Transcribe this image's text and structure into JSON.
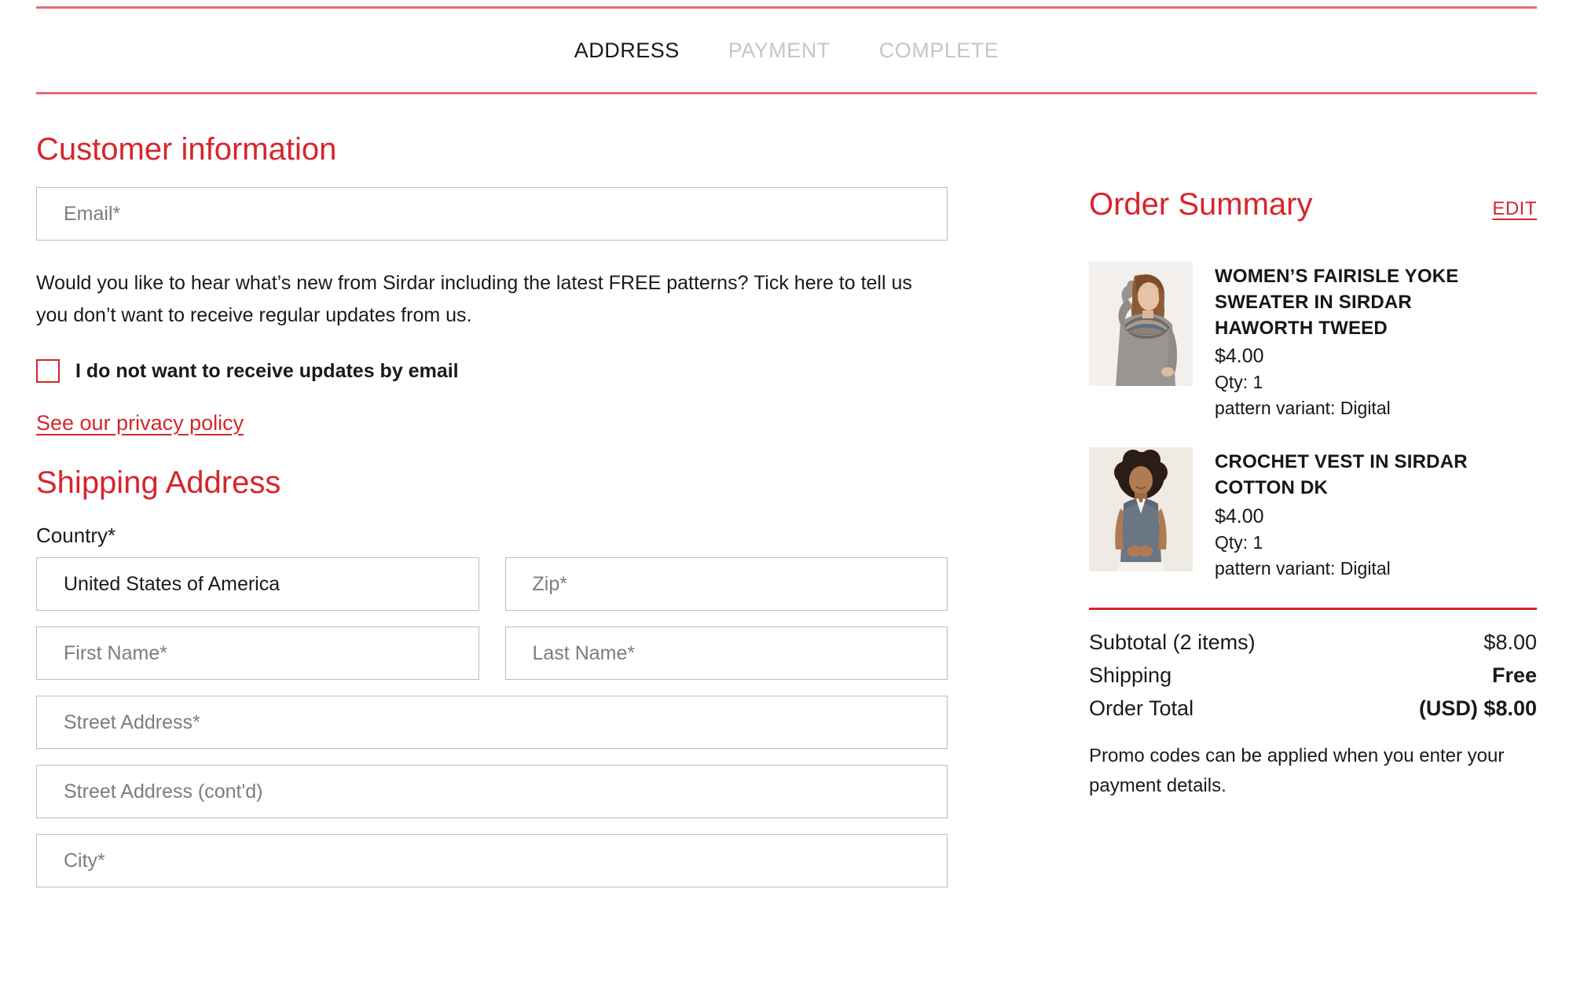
{
  "steps": [
    {
      "label": "ADDRESS",
      "state": "active"
    },
    {
      "label": "PAYMENT",
      "state": "inactive"
    },
    {
      "label": "COMPLETE",
      "state": "inactive"
    }
  ],
  "customer": {
    "title": "Customer information",
    "email_placeholder": "Email*",
    "marketing_text": "Would you like to hear what’s new from Sirdar including the latest FREE patterns? Tick here to tell us you don’t want to receive regular updates from us.",
    "optout_label": "I do not want to receive updates by email",
    "optout_checked": false,
    "privacy_link": "See our privacy policy"
  },
  "shipping": {
    "title": "Shipping Address",
    "country_label": "Country*",
    "country_value": "United States of America",
    "zip_placeholder": "Zip*",
    "first_name_placeholder": "First Name*",
    "last_name_placeholder": "Last Name*",
    "street_placeholder": "Street Address*",
    "street2_placeholder": "Street Address (cont'd)",
    "city_placeholder": "City*"
  },
  "summary": {
    "title": "Order Summary",
    "edit_label": "EDIT",
    "items": [
      {
        "name": "WOMEN’S FAIRISLE YOKE SWEATER IN SIRDAR HAWORTH TWEED",
        "price": "$4.00",
        "qty": "Qty: 1",
        "variant": "pattern variant: Digital"
      },
      {
        "name": "CROCHET VEST IN SIRDAR COTTON DK",
        "price": "$4.00",
        "qty": "Qty: 1",
        "variant": "pattern variant: Digital"
      }
    ],
    "totals": [
      {
        "label": "Subtotal (2 items)",
        "amount": "$8.00",
        "bold": false
      },
      {
        "label": "Shipping",
        "amount": "Free",
        "bold": true
      },
      {
        "label": "Order Total",
        "amount": "(USD) $8.00",
        "bold": true
      }
    ],
    "promo_note": "Promo codes can be applied when you enter your payment details."
  },
  "colors": {
    "brand_red": "#d5262c",
    "rule_pink": "#e8697d",
    "input_border": "#bdbdbd",
    "placeholder": "#7d7d7d"
  }
}
